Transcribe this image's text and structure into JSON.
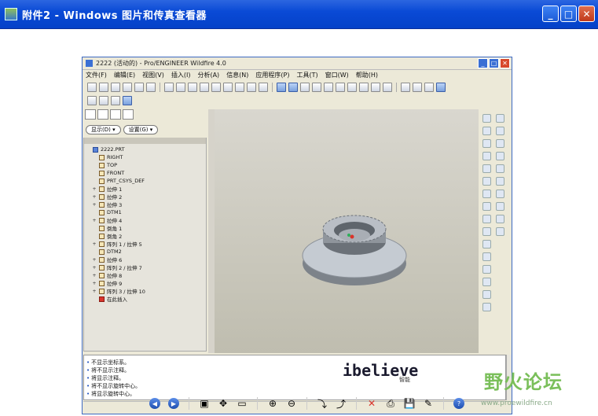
{
  "outer_window": {
    "title": "附件2 - Windows 图片和传真查看器"
  },
  "inner_window": {
    "title": "2222 (活动的) - Pro/ENGINEER Wildfire 4.0",
    "menu": [
      "文件(F)",
      "编辑(E)",
      "视图(V)",
      "插入(I)",
      "分析(A)",
      "信息(N)",
      "应用程序(P)",
      "工具(T)",
      "窗口(W)",
      "帮助(H)"
    ]
  },
  "show_bar": {
    "show_label": "显示(D) ▾",
    "settings_label": "设置(G) ▾"
  },
  "model_tree": [
    {
      "label": "2222.PRT",
      "indent": 0,
      "expander": "",
      "kind": "blue"
    },
    {
      "label": "RIGHT",
      "indent": 1,
      "expander": "",
      "kind": "plane"
    },
    {
      "label": "TOP",
      "indent": 1,
      "expander": "",
      "kind": "plane"
    },
    {
      "label": "FRONT",
      "indent": 1,
      "expander": "",
      "kind": "plane"
    },
    {
      "label": "PRT_CSYS_DEF",
      "indent": 1,
      "expander": "",
      "kind": "csys"
    },
    {
      "label": "拉伸 1",
      "indent": 1,
      "expander": "+",
      "kind": "feat"
    },
    {
      "label": "拉伸 2",
      "indent": 1,
      "expander": "+",
      "kind": "feat"
    },
    {
      "label": "拉伸 3",
      "indent": 1,
      "expander": "+",
      "kind": "feat"
    },
    {
      "label": "DTM1",
      "indent": 1,
      "expander": "",
      "kind": "plane"
    },
    {
      "label": "拉伸 4",
      "indent": 1,
      "expander": "+",
      "kind": "feat"
    },
    {
      "label": "倒角 1",
      "indent": 1,
      "expander": "",
      "kind": "feat"
    },
    {
      "label": "倒角 2",
      "indent": 1,
      "expander": "",
      "kind": "feat"
    },
    {
      "label": "阵列 1 / 拉伸 5",
      "indent": 1,
      "expander": "+",
      "kind": "pattern"
    },
    {
      "label": "DTM2",
      "indent": 1,
      "expander": "",
      "kind": "plane"
    },
    {
      "label": "拉伸 6",
      "indent": 1,
      "expander": "+",
      "kind": "feat"
    },
    {
      "label": "阵列 2 / 拉伸 7",
      "indent": 1,
      "expander": "+",
      "kind": "pattern"
    },
    {
      "label": "拉伸 8",
      "indent": 1,
      "expander": "+",
      "kind": "feat"
    },
    {
      "label": "拉伸 9",
      "indent": 1,
      "expander": "+",
      "kind": "feat"
    },
    {
      "label": "阵列 3 / 拉伸 10",
      "indent": 1,
      "expander": "+",
      "kind": "pattern"
    },
    {
      "label": "在此插入",
      "indent": 1,
      "expander": "",
      "kind": "red"
    }
  ],
  "messages": [
    "不显示坐标系。",
    "将不显示注释。",
    "将显示注释。",
    "将不显示旋转中心。",
    "将显示旋转中心。"
  ],
  "watermark": {
    "logo": "ibelieve",
    "sub": "智能",
    "site_cn": "野火论坛",
    "url": "www.proewildfire.cn"
  }
}
